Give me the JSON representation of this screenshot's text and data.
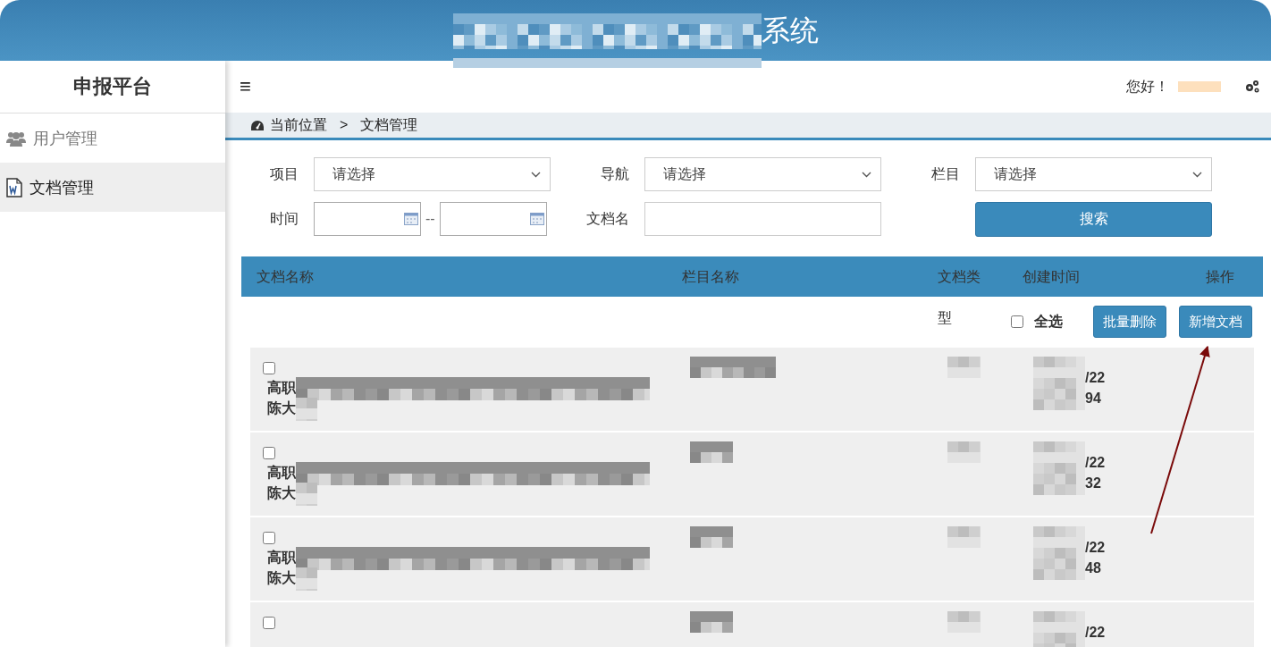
{
  "header": {
    "title": "系统"
  },
  "sidebar": {
    "title": "申报平台",
    "items": [
      {
        "label": "用户管理",
        "selected": false
      },
      {
        "label": "文档管理",
        "selected": true
      }
    ]
  },
  "topbar": {
    "menu": "≡",
    "greeting": "您好！"
  },
  "breadcrumb": {
    "label": "当前位置",
    "separator": ">",
    "current": "文档管理"
  },
  "filters": [
    {
      "kind": "select",
      "label": "项目",
      "value": "请选择"
    },
    {
      "kind": "select",
      "label": "导航",
      "value": "请选择"
    },
    {
      "kind": "select",
      "label": "栏目",
      "value": "请选择"
    },
    {
      "kind": "daterange",
      "label": "时间",
      "separator": "--"
    },
    {
      "kind": "text",
      "label": "文档名"
    },
    {
      "kind": "button",
      "text": "搜索"
    }
  ],
  "table": {
    "columns": [
      "文档名称",
      "栏目名称",
      "文档类型",
      "创建时间",
      "操作"
    ],
    "toolbar": {
      "select_all": {
        "label": "全选",
        "checked": false
      },
      "buttons": [
        "批量删除",
        "新增文档"
      ]
    },
    "rows": [
      {
        "checked": false,
        "name_lines": [
          "高职",
          "陈大"
        ],
        "date_lines": [
          "/22",
          "94"
        ]
      },
      {
        "checked": false,
        "name_lines": [
          "高职",
          "陈大"
        ],
        "date_lines": [
          "/22",
          "32"
        ]
      },
      {
        "checked": false,
        "name_lines": [
          "高职",
          "陈大"
        ],
        "date_lines": [
          "/22",
          "48"
        ]
      },
      {
        "checked": false,
        "date_lines": [
          "/22"
        ]
      }
    ]
  }
}
